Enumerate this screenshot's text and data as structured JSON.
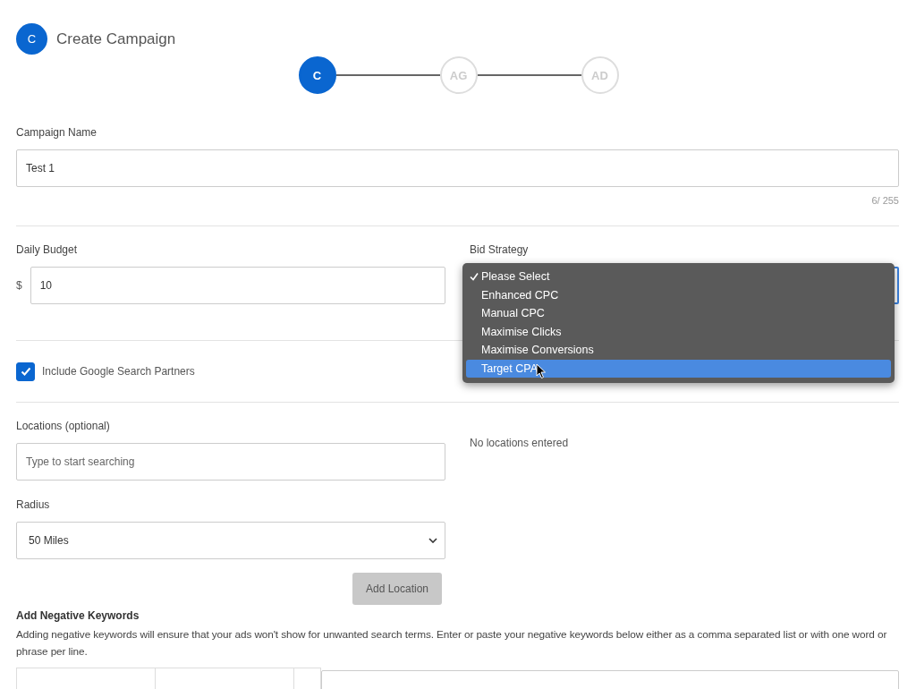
{
  "header": {
    "badge": "C",
    "title": "Create Campaign"
  },
  "steps": [
    {
      "label": "C",
      "selected": true
    },
    {
      "label": "AG",
      "selected": false
    },
    {
      "label": "AD",
      "selected": false
    }
  ],
  "campaign_name": {
    "label": "Campaign Name",
    "value": "Test 1",
    "counter": "6/ 255"
  },
  "daily_budget": {
    "label": "Daily Budget",
    "currency": "$",
    "value": "10"
  },
  "bid_strategy": {
    "label": "Bid Strategy",
    "expanded": true,
    "options": [
      {
        "label": "Please Select",
        "selected": true,
        "highlighted": false
      },
      {
        "label": "Enhanced CPC",
        "selected": false,
        "highlighted": false
      },
      {
        "label": "Manual CPC",
        "selected": false,
        "highlighted": false
      },
      {
        "label": "Maximise Clicks",
        "selected": false,
        "highlighted": false
      },
      {
        "label": "Maximise Conversions",
        "selected": false,
        "highlighted": false
      },
      {
        "label": "Target CPA",
        "selected": false,
        "highlighted": true
      }
    ]
  },
  "search_partners": {
    "label": "Include Google Search Partners",
    "checked": true
  },
  "locations": {
    "label": "Locations (optional)",
    "placeholder": "Type to start searching",
    "empty_text": "No locations entered"
  },
  "radius": {
    "label": "Radius",
    "value": "50 Miles"
  },
  "add_location": {
    "label": "Add Location",
    "disabled": true
  },
  "negative_keywords": {
    "title": "Add Negative Keywords",
    "description": "Adding negative keywords will ensure that your ads won't show for unwanted search terms. Enter or paste your negative keywords below either as a comma separated list or with one word or phrase per line."
  }
}
